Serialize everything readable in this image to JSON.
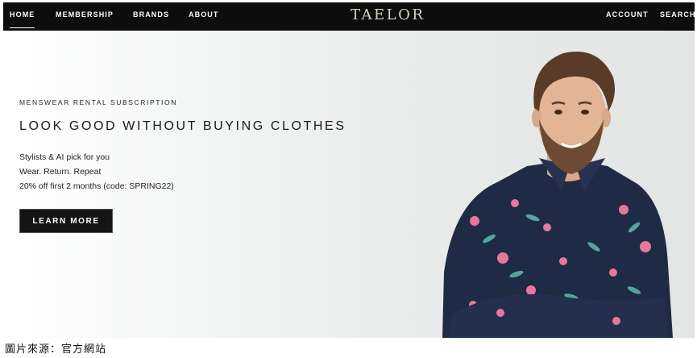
{
  "nav": {
    "left": [
      "HOME",
      "MEMBERSHIP",
      "BRANDS",
      "ABOUT"
    ],
    "logo": "TAELOR",
    "right": [
      "ACCOUNT",
      "SEARCH"
    ]
  },
  "hero": {
    "eyebrow": "MENSWEAR RENTAL SUBSCRIPTION",
    "headline": "LOOK GOOD WITHOUT BUYING CLOTHES",
    "features": [
      "Stylists & AI pick for you",
      "Wear. Return. Repeat",
      "20% off first 2 months (code: SPRING22)"
    ],
    "cta": "LEARN MORE"
  },
  "caption": "圖片來源：官方網站",
  "colors": {
    "navbar": "#0d0d0d",
    "logo": "#d9cfc2",
    "cta": "#141414",
    "shirt": "#1f2a44"
  }
}
